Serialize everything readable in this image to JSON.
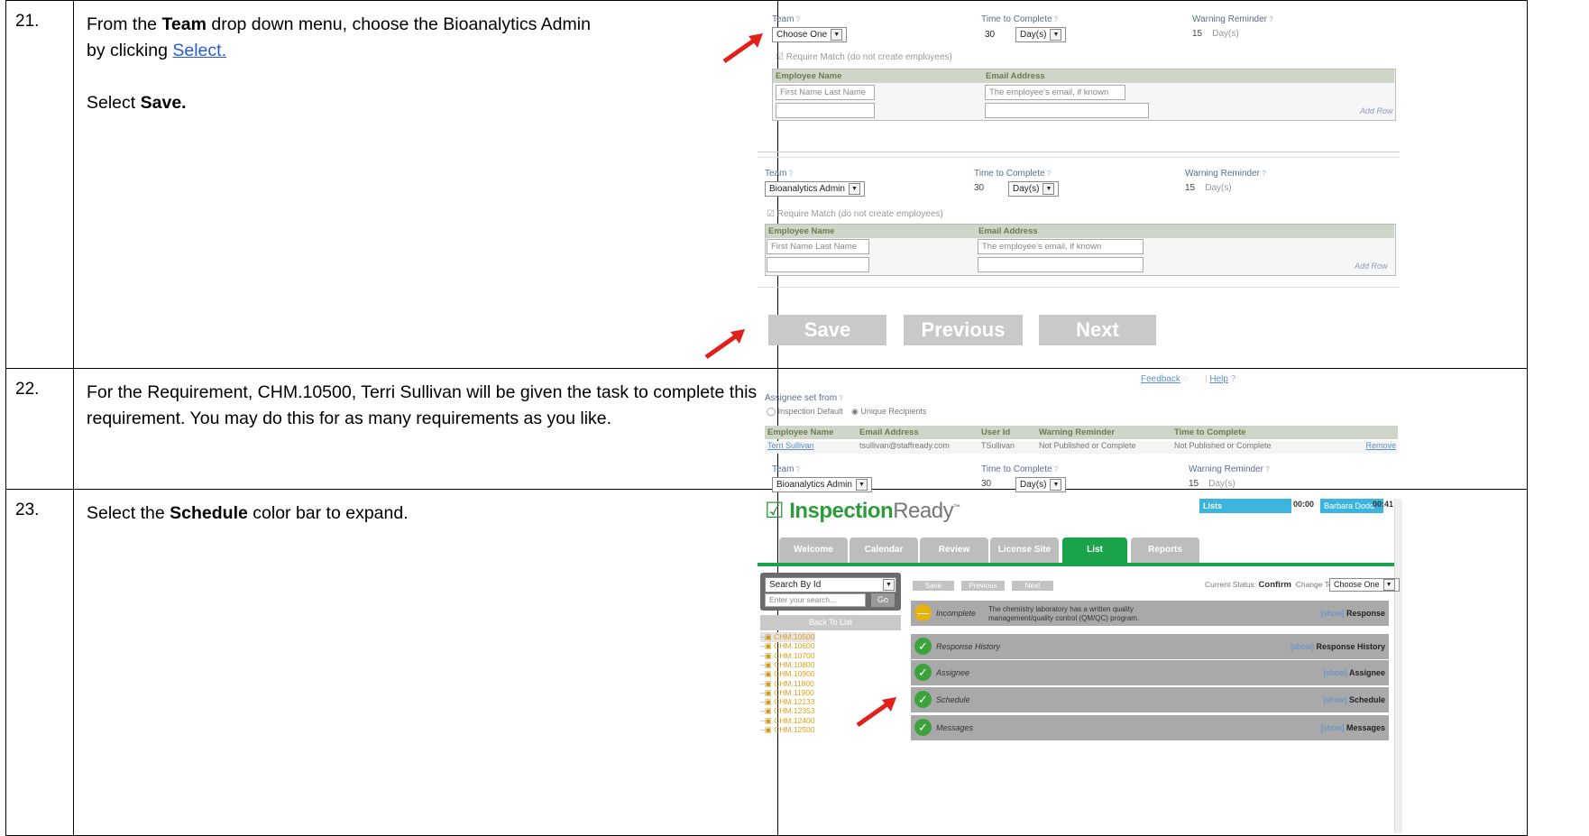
{
  "rows": [
    {
      "num": "21.",
      "line1_pre": "From the ",
      "line1_bold": "Team",
      "line1_post": " drop down menu, choose the Bioanalytics Admin",
      "line2_pre": "by clicking ",
      "line2_link": "Select.",
      "line3_pre": "Select ",
      "line3_bold": "Save."
    },
    {
      "num": "22.",
      "text": "For the Requirement, CHM.10500, Terri Sullivan will be given the task to complete this requirement.  You may do this for as many requirements as you like."
    },
    {
      "num": "23.",
      "text_pre": "Select the ",
      "text_bold": "Schedule",
      "text_post": " color bar to expand."
    }
  ],
  "shot1": {
    "team_label": "Team",
    "time_label": "Time to Complete",
    "warn_label": "Warning Reminder",
    "team_value_a": "Choose One",
    "team_value_b": "Bioanalytics Admin",
    "time_value": "30",
    "time_unit": "Day(s)",
    "warn_value": "15",
    "warn_unit": "Day(s)",
    "require_match": "Require Match (do not create employees)",
    "col_name": "Employee Name",
    "col_email": "Email Address",
    "name_placeholder": "First Name  Last Name",
    "email_placeholder": "The employee's email, if known",
    "add_row": "Add Row",
    "btn_save": "Save",
    "btn_previous": "Previous",
    "btn_next": "Next"
  },
  "shot2": {
    "feedback": "Feedback",
    "help": "Help",
    "assignee_set_from": "Assignee set from",
    "opt_default": "Inspection Default",
    "opt_unique": "Unique Recipients",
    "cols": [
      "Employee Name",
      "Email Address",
      "User Id",
      "Warning Reminder",
      "Time to Complete"
    ],
    "row": [
      "Terri Sullivan",
      "tsullivan@staffready.com",
      "TSullivan",
      "Not Published or Complete",
      "Not Published or Complete"
    ],
    "remove": "Remove",
    "team_label": "Team",
    "team_value": "Bioanalytics Admin",
    "time_label": "Time to Complete",
    "time_value": "30",
    "time_unit": "Day(s)",
    "warn_label": "Warning Reminder",
    "warn_value": "15",
    "warn_unit": "Day(s)"
  },
  "shot3": {
    "logo_inspection": "Inspection",
    "logo_ready": "Ready",
    "top_lists": "Lists",
    "top_time1": "00:00",
    "top_user": "Barbara Dodd",
    "top_time2": "00:41",
    "tabs": [
      "Welcome",
      "Calendar",
      "Review",
      "License Site",
      "List",
      "Reports"
    ],
    "search_by": "Search By Id",
    "search_placeholder": "Enter your search...",
    "go": "Go",
    "back_to_list": "Back To List",
    "tree_items": [
      "CHM.10500",
      "CHM.10600",
      "CHM.10700",
      "CHM.10800",
      "CHM.10900",
      "CHM.11800",
      "CHM.11900",
      "CHM.12133",
      "CHM.12353",
      "CHM.12400",
      "CHM.12500"
    ],
    "mini_save": "Save",
    "mini_previous": "Previous",
    "mini_next": "Next",
    "current_status_label": "Current Status:",
    "current_status_value": "Confirm",
    "change_to_label": "Change To:",
    "change_to_value": "Choose One",
    "bars": [
      {
        "status": "Incomplete",
        "desc": "The chemistry laboratory has a written quality management/quality control (QM/QC) program.",
        "show": "[show]",
        "title": "Response"
      },
      {
        "status": "Response History",
        "desc": "",
        "show": "[show]",
        "title": "Response History"
      },
      {
        "status": "Assignee",
        "desc": "",
        "show": "[show]",
        "title": "Assignee"
      },
      {
        "status": "Schedule",
        "desc": "",
        "show": "[show]",
        "title": "Schedule"
      },
      {
        "status": "Messages",
        "desc": "",
        "show": "[show]",
        "title": "Messages"
      }
    ]
  },
  "colors": {
    "link_blue": "#2a5bd7",
    "arrow_red": "#e0201b",
    "tab_green": "#1aa34a",
    "bar_gray": "#a9a9a9",
    "check_green": "#3ca33c",
    "warn_yellow": "#e7b10f"
  }
}
